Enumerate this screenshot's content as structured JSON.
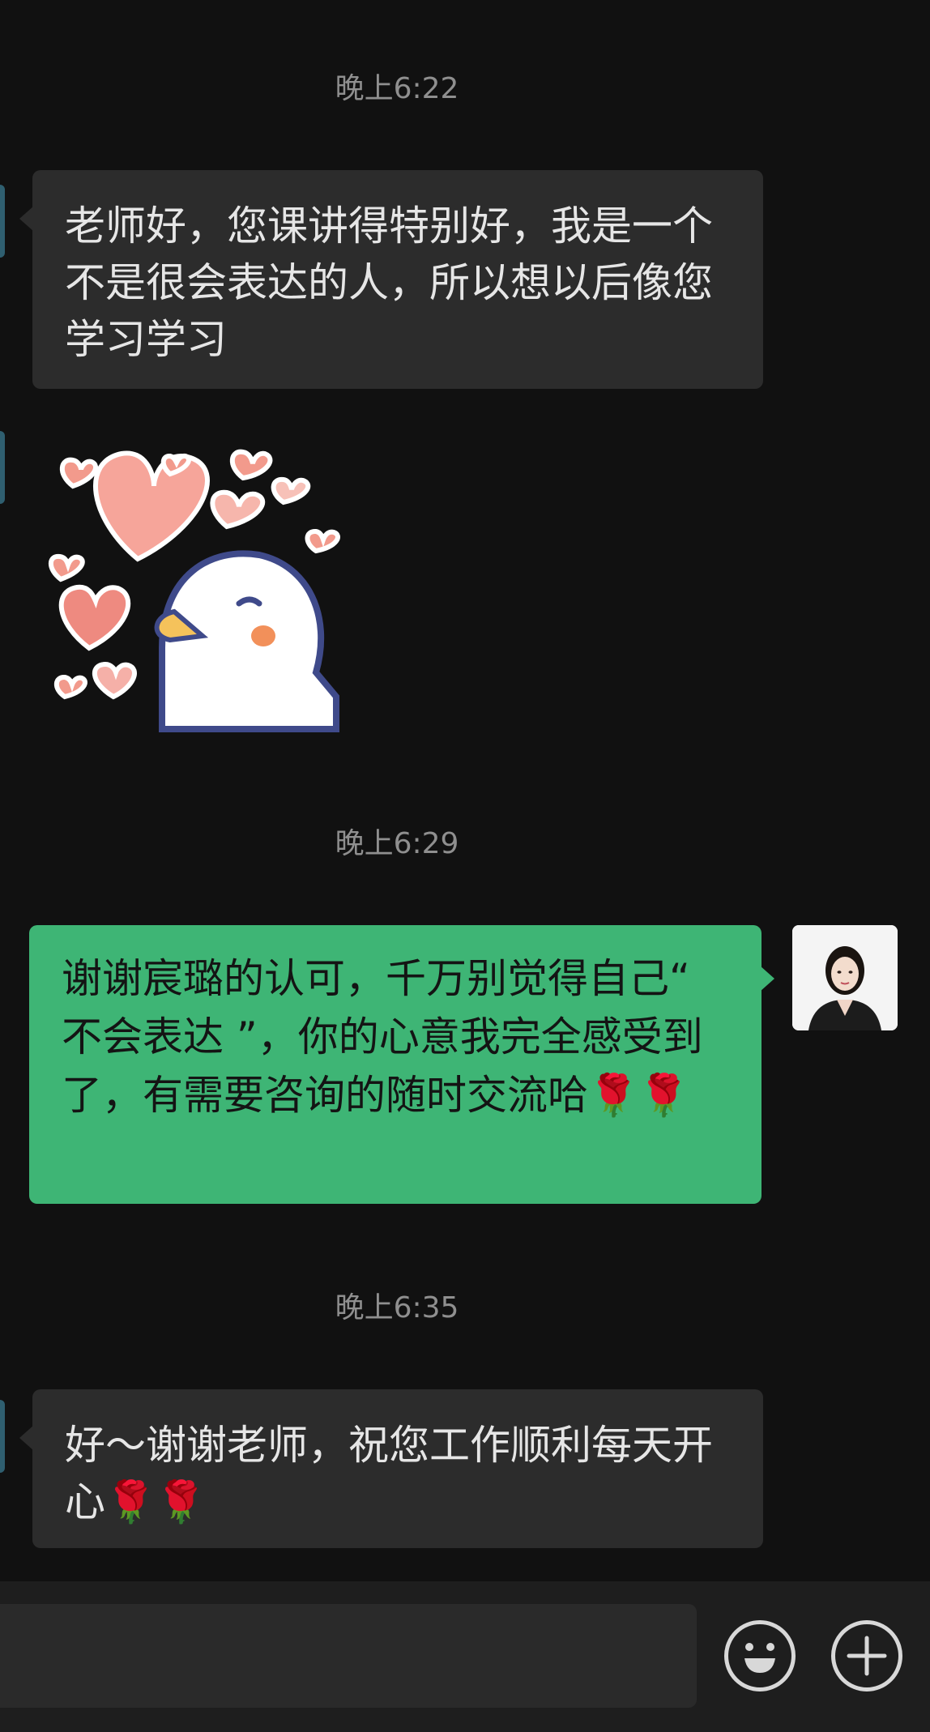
{
  "messages": [
    {
      "type": "time",
      "text": "晚上6:22"
    },
    {
      "type": "incoming",
      "text": "老师好，您课讲得特别好，我是一个不是很会表达的人，所以想以后像您学习学习"
    },
    {
      "type": "incoming-sticker",
      "icon": "duck-hearts-sticker"
    },
    {
      "type": "time",
      "text": "晚上6:29"
    },
    {
      "type": "outgoing",
      "text": "谢谢宸璐的认可，千万别觉得自己“ 不会表达 ”，你的心意我完全感受到了，有需要咨询的随时交流哈🌹🌹"
    },
    {
      "type": "time",
      "text": "晚上6:35"
    },
    {
      "type": "incoming",
      "text": "好～谢谢老师，祝您工作顺利每天开心🌹🌹"
    }
  ],
  "input_bar": {
    "emoji_icon": "smiley-icon",
    "plus_icon": "plus-circle-icon"
  },
  "colors": {
    "background": "#111111",
    "incoming_bubble": "#2c2c2c",
    "outgoing_bubble": "#3eb575",
    "timestamp": "#8f8f8f"
  }
}
